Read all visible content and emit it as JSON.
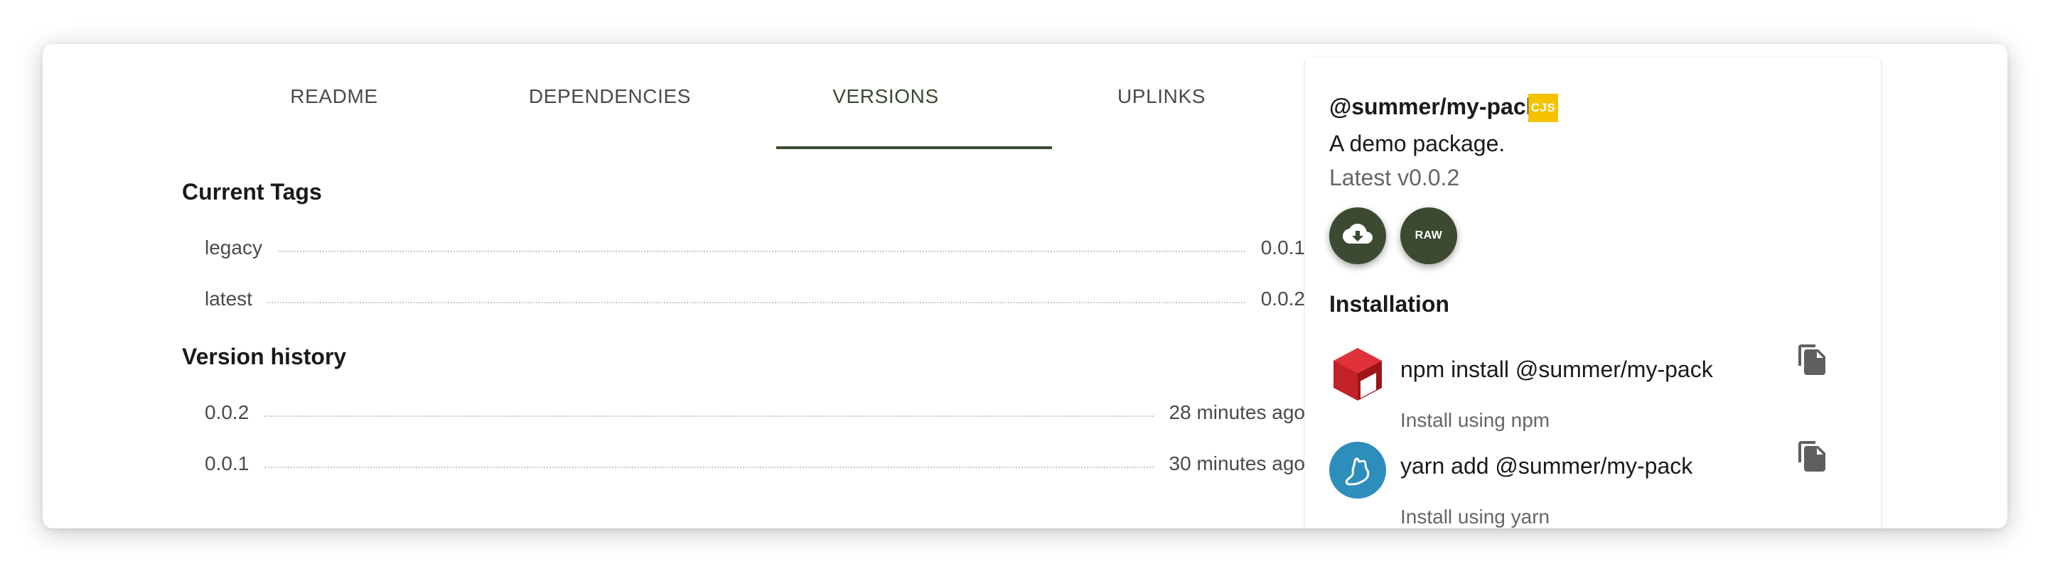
{
  "tabs": [
    {
      "label": "README"
    },
    {
      "label": "DEPENDENCIES"
    },
    {
      "label": "VERSIONS",
      "active": true
    },
    {
      "label": "UPLINKS"
    }
  ],
  "current_tags": {
    "title": "Current Tags",
    "rows": [
      {
        "name": "legacy",
        "version": "0.0.1"
      },
      {
        "name": "latest",
        "version": "0.0.2"
      }
    ]
  },
  "version_history": {
    "title": "Version history",
    "rows": [
      {
        "version": "0.0.2",
        "time": "28 minutes ago"
      },
      {
        "version": "0.0.1",
        "time": "30 minutes ago"
      }
    ]
  },
  "package": {
    "name": "@summer/my-pack",
    "module_badge": "CJS",
    "description": "A demo package.",
    "latest": "Latest v0.0.2",
    "download_icon": "cloud-download-icon",
    "raw_label": "RAW"
  },
  "installation": {
    "title": "Installation",
    "items": [
      {
        "command": "npm install @summer/my-pack",
        "subtitle": "Install using npm",
        "icon": "npm-icon"
      },
      {
        "command": "yarn add @summer/my-pack",
        "subtitle": "Install using yarn",
        "icon": "yarn-icon"
      }
    ]
  },
  "colors": {
    "accent": "#3d4b32",
    "badge": "#f5c200",
    "npm": "#c12127",
    "yarn": "#2c8ebb"
  }
}
